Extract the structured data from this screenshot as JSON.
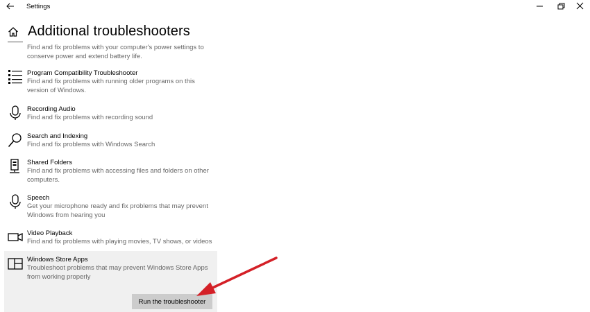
{
  "window": {
    "title": "Settings"
  },
  "page": {
    "title": "Additional troubleshooters"
  },
  "top_partial": {
    "description": "Find and fix problems with your computer's power settings to conserve power and extend battery life."
  },
  "items": [
    {
      "name": "Program Compatibility Troubleshooter",
      "description": "Find and fix problems with running older programs on this version of Windows.",
      "icon": "list-icon"
    },
    {
      "name": "Recording Audio",
      "description": "Find and fix problems with recording sound",
      "icon": "microphone-icon"
    },
    {
      "name": "Search and Indexing",
      "description": "Find and fix problems with Windows Search",
      "icon": "search-icon"
    },
    {
      "name": "Shared Folders",
      "description": "Find and fix problems with accessing files and folders on other computers.",
      "icon": "shared-folder-icon"
    },
    {
      "name": "Speech",
      "description": "Get your microphone ready and fix problems that may prevent Windows from hearing you",
      "icon": "microphone-icon"
    },
    {
      "name": "Video Playback",
      "description": "Find and fix problems with playing movies, TV shows, or videos",
      "icon": "video-icon"
    },
    {
      "name": "Windows Store Apps",
      "description": "Troubleshoot problems that may prevent Windows Store Apps from working properly",
      "icon": "store-apps-icon"
    }
  ],
  "run_button": {
    "label": "Run the troubleshooter"
  },
  "colors": {
    "accent_arrow": "#d42027",
    "selected_bg": "#f0f0f0",
    "button_bg": "#cccccc"
  }
}
